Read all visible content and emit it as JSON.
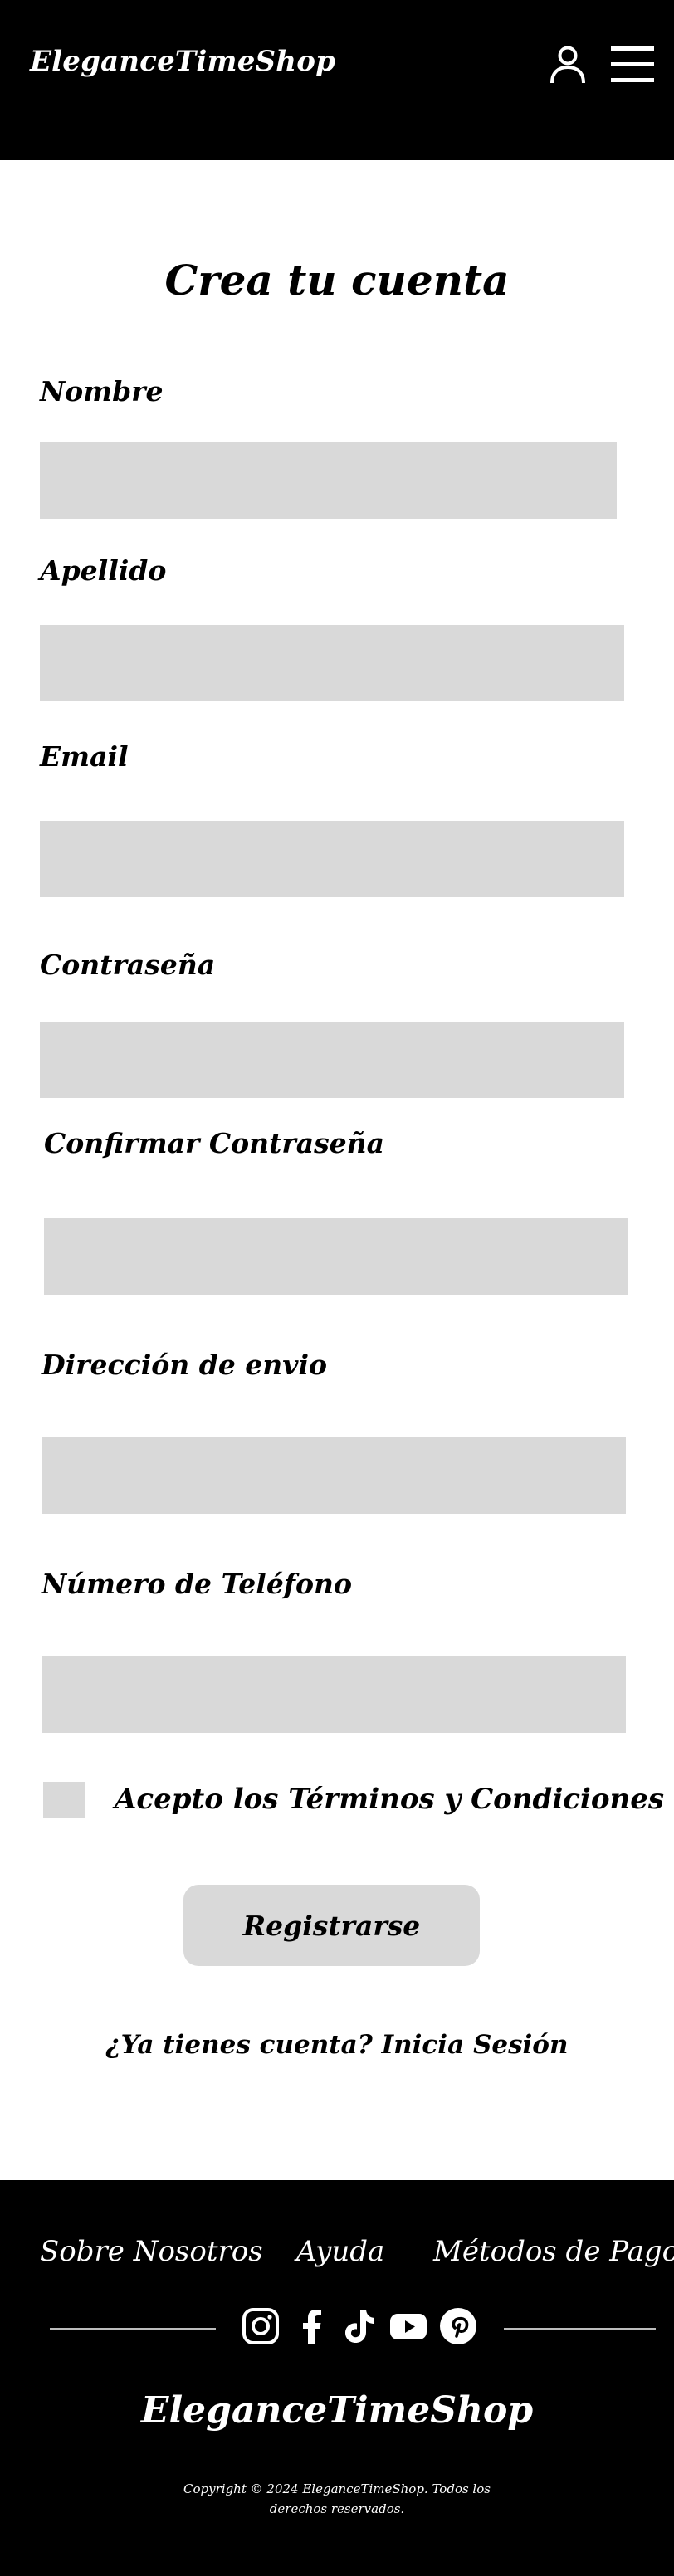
{
  "header": {
    "brand": "EleganceTimeShop",
    "icons": {
      "account": "user-icon",
      "menu": "hamburger-menu-icon"
    }
  },
  "form": {
    "title": "Crea tu cuenta",
    "fields": {
      "nombre": {
        "label": "Nombre",
        "value": ""
      },
      "apellido": {
        "label": "Apellido",
        "value": ""
      },
      "email": {
        "label": "Email",
        "value": ""
      },
      "password": {
        "label": "Contraseña",
        "value": ""
      },
      "confirm_password": {
        "label": "Confirmar Contraseña",
        "value": ""
      },
      "address": {
        "label": "Dirección de envio",
        "value": ""
      },
      "phone": {
        "label": "Número de Teléfono",
        "value": ""
      }
    },
    "terms": {
      "label": "Acepto los Términos y Condiciones",
      "checked": false
    },
    "submit_label": "Registrarse",
    "login_prompt": "¿Ya tienes cuenta? Inicia Sesión"
  },
  "footer": {
    "links": [
      "Sobre Nosotros",
      "Ayuda",
      "Métodos de Pago"
    ],
    "social_icons": [
      "instagram-icon",
      "facebook-icon",
      "tiktok-icon",
      "youtube-icon",
      "pinterest-icon"
    ],
    "brand": "EleganceTimeShop",
    "copyright": "Copyright © 2024 EleganceTimeShop. Todos los derechos reservados."
  },
  "colors": {
    "dark": "#000000",
    "field": "#d9d9d9",
    "page": "#ffffff"
  }
}
